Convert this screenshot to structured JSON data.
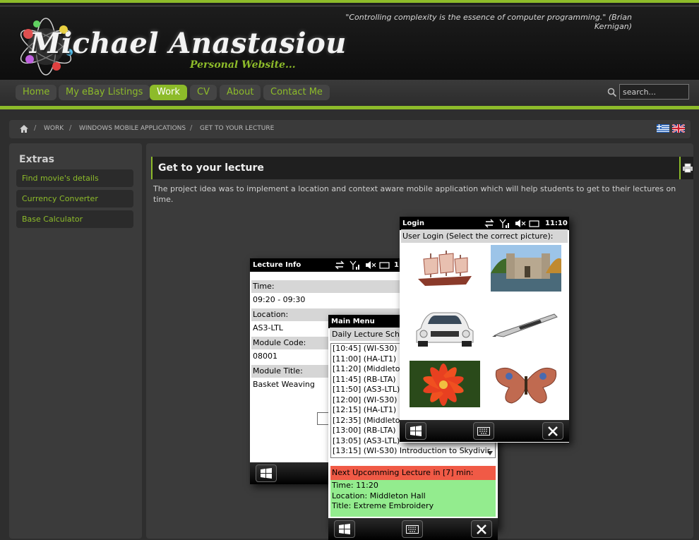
{
  "header": {
    "quote": "\"Controlling complexity is the essence of computer programming.\" (Brian Kernigan)",
    "site_name": "Michael  Anastasiou",
    "tagline": "Personal Website..."
  },
  "nav": {
    "items": [
      "Home",
      "My eBay Listings",
      "Work",
      "CV",
      "About",
      "Contact Me"
    ],
    "active": "Work"
  },
  "search": {
    "placeholder": "search..."
  },
  "breadcrumb": [
    "WORK",
    "WINDOWS MOBILE APPLICATIONS",
    "GET TO YOUR LECTURE"
  ],
  "sidebar": {
    "title": "Extras",
    "items": [
      "Find movie's details",
      "Currency Converter",
      "Base Calculator"
    ]
  },
  "article": {
    "title": "Get to your lecture",
    "text": "The project idea was to implement a location and context aware mobile application which will help students to get to their lectures on time."
  },
  "phone_lecture": {
    "title": "Lecture Info",
    "clock": "1",
    "fields": [
      {
        "label": "Time:",
        "value": "09:20 - 09:30"
      },
      {
        "label": "Location:",
        "value": "AS3-LTL"
      },
      {
        "label": "Module Code:",
        "value": "08001"
      },
      {
        "label": "Module Title:",
        "value": "Basket Weaving"
      }
    ]
  },
  "phone_menu": {
    "title": "Main Menu",
    "schedule_title": "Daily Lecture Sche",
    "schedule": [
      "[10:45] (WI-S30)",
      "[11:00] (HA-LT1)",
      "[11:20] (Middleton",
      "[11:45] (RB-LTA)",
      "[11:50] (AS3-LTL)",
      "[12:00] (WI-S30)",
      "[12:15] (HA-LT1)",
      "[12:35] (Middleton",
      "[13:00] (RB-LTA)",
      "[13:05] (AS3-LTL)",
      "[13:15] (WI-S30) Introduction to Skydivir"
    ],
    "next_heading": "Next Upcomming Lecture in [7] min:",
    "next_time": "Time: 11:20",
    "next_location": "Location: Middleton Hall",
    "next_title": "Title: Extreme Embroidery"
  },
  "phone_login": {
    "title": "Login",
    "clock": "11:10",
    "prompt": "User Login (Select the correct picture):",
    "pictures": [
      "ship",
      "castle",
      "car",
      "pen",
      "flower",
      "butterfly"
    ]
  },
  "colors": {
    "accent": "#8dbb2a",
    "next_lecture_head": "#f05a46",
    "next_lecture_body": "#93ec8e"
  }
}
